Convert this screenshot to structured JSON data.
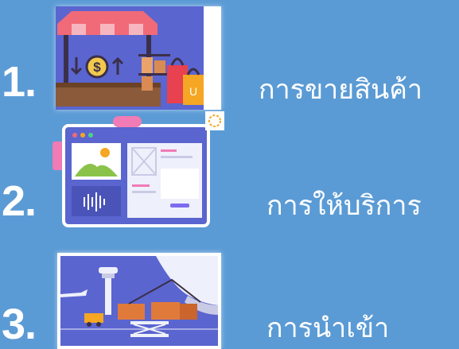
{
  "items": [
    {
      "number": "1.",
      "label": "การขายสินค้า",
      "icon": "market-stall-icon"
    },
    {
      "number": "2.",
      "label": "การให้บริการ",
      "icon": "web-service-icon"
    },
    {
      "number": "3.",
      "label": "การนำเข้า",
      "icon": "air-cargo-icon"
    }
  ],
  "colors": {
    "background": "#5b9bd5",
    "thumb_fill": "#5a65cf",
    "text": "#ffffff"
  }
}
